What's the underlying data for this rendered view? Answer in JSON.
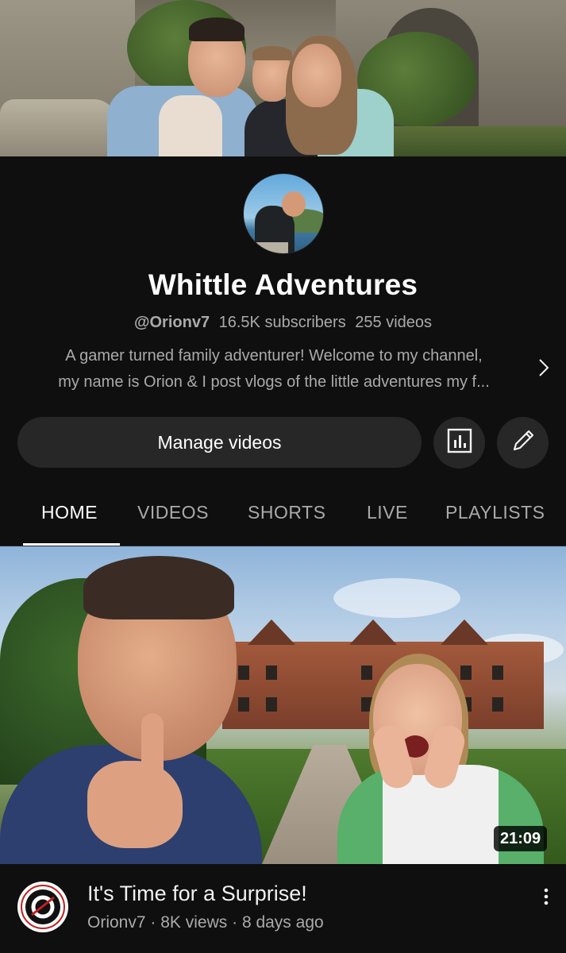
{
  "channel": {
    "name": "Whittle Adventures",
    "handle": "@Orionv7",
    "subscribers": "16.5K subscribers",
    "videos": "255 videos",
    "description_line1": "A gamer turned family adventurer! Welcome to my channel,",
    "description_line2": "my name is Orion & I post vlogs of the little adventures my f..."
  },
  "actions": {
    "manage_videos": "Manage videos",
    "analytics_icon": "analytics-icon",
    "edit_icon": "pencil-icon"
  },
  "tabs": [
    {
      "label": "HOME",
      "active": true
    },
    {
      "label": "VIDEOS",
      "active": false
    },
    {
      "label": "SHORTS",
      "active": false
    },
    {
      "label": "LIVE",
      "active": false
    },
    {
      "label": "PLAYLISTS",
      "active": false
    }
  ],
  "featured_video": {
    "title": "It's Time for a Surprise!",
    "channel": "Orionv7",
    "views": "8K views",
    "age": "8 days ago",
    "separator": "·",
    "duration": "21:09"
  },
  "colors": {
    "background": "#0f0f0f",
    "button": "#272727",
    "text_primary": "#f1f1f1",
    "text_secondary": "#aaaaaa"
  }
}
